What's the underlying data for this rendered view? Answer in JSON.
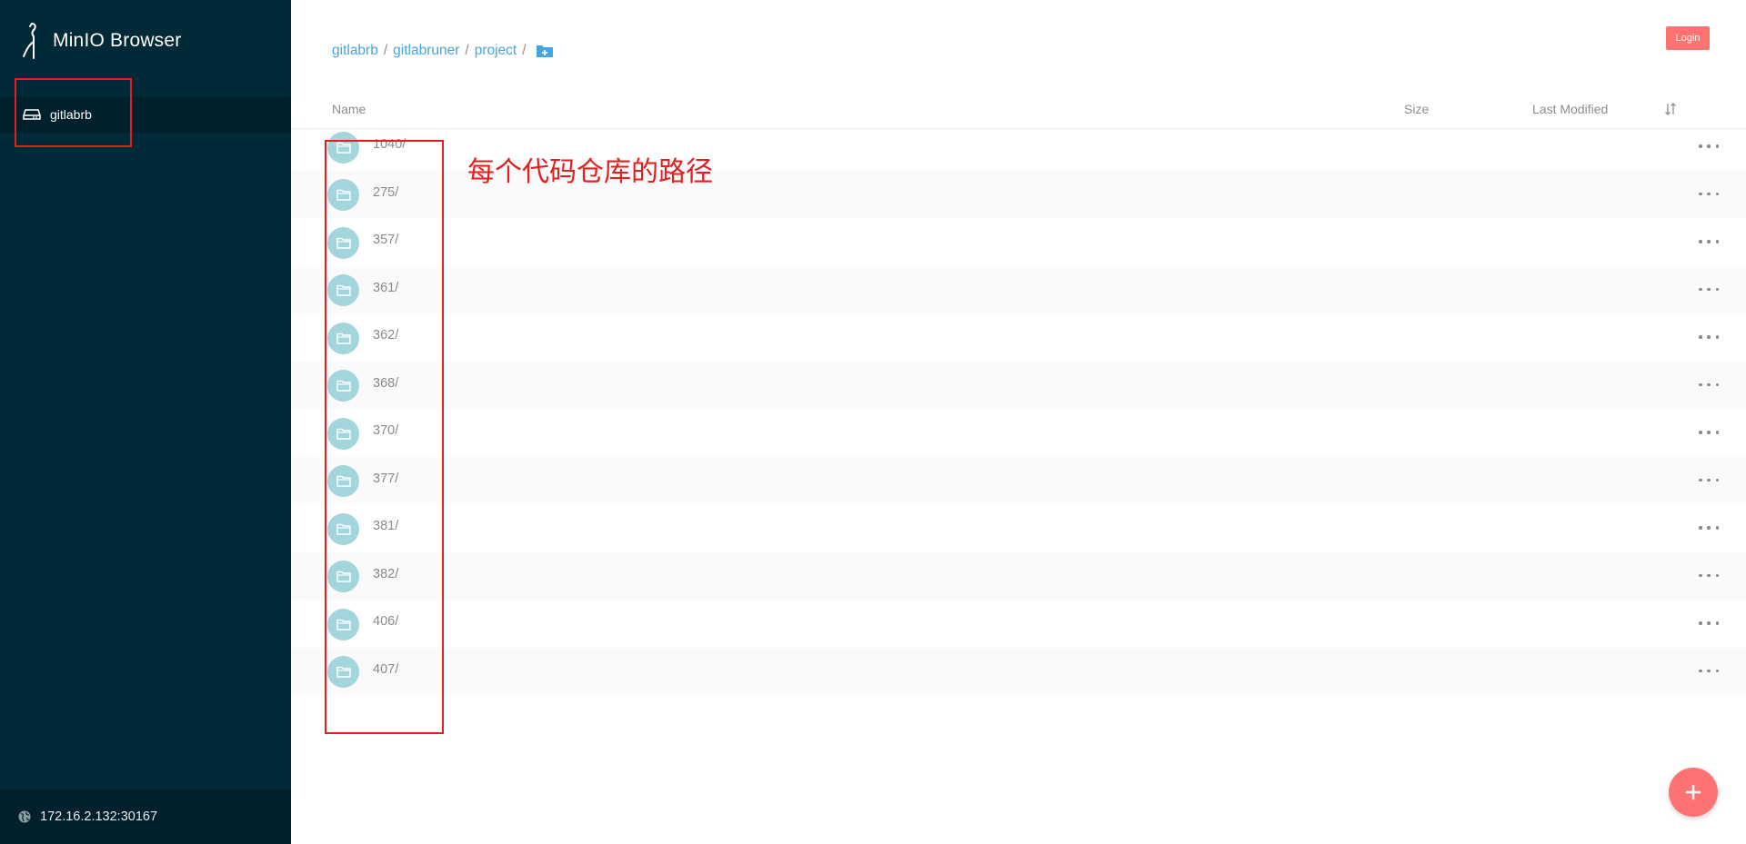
{
  "app": {
    "title": "MinIO Browser",
    "logo_icon": "minio-bird-logo-icon"
  },
  "sidebar": {
    "buckets": [
      {
        "label": "gitlabrb",
        "icon": "drive-icon",
        "active": true
      }
    ],
    "host": {
      "label": "172.16.2.132:30167",
      "icon": "globe-icon"
    }
  },
  "breadcrumb": {
    "items": [
      "gitlabrb",
      "gitlabruner",
      "project"
    ],
    "separator": "/",
    "add_icon": "add-folder-icon"
  },
  "header": {
    "login_label": "Login"
  },
  "list": {
    "columns": {
      "name": "Name",
      "size": "Size",
      "last_modified": "Last Modified",
      "sort_icon": "sort-icon"
    },
    "rows": [
      {
        "name": "1040/"
      },
      {
        "name": "275/"
      },
      {
        "name": "357/"
      },
      {
        "name": "361/"
      },
      {
        "name": "362/"
      },
      {
        "name": "368/"
      },
      {
        "name": "370/"
      },
      {
        "name": "377/"
      },
      {
        "name": "381/"
      },
      {
        "name": "382/"
      },
      {
        "name": "406/"
      },
      {
        "name": "407/"
      }
    ]
  },
  "annotation": {
    "text": "每个代码仓库的路径",
    "color": "#e41e1e"
  },
  "colors": {
    "sidebar_bg": "#002a37",
    "accent": "#ff7272",
    "link": "#46a5e0",
    "folder_circle": "#a2d5dc"
  }
}
